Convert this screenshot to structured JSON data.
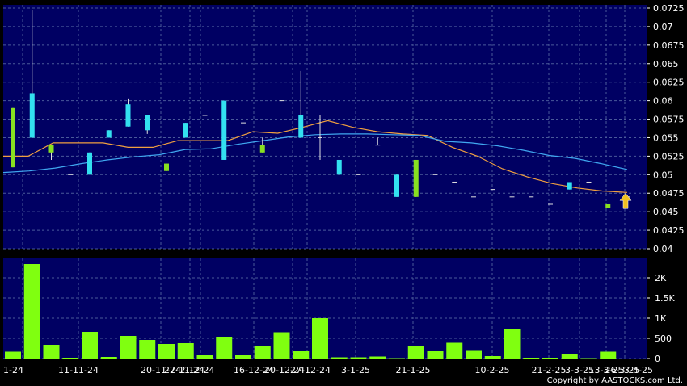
{
  "chart_data": [
    {
      "type": "candlestick",
      "title": "",
      "ylabel": "",
      "ylim": [
        0.04,
        0.0725
      ],
      "y_ticks": [
        "0.04",
        "0.0425",
        "0.045",
        "0.0475",
        "0.05",
        "0.0525",
        "0.055",
        "0.0575",
        "0.06",
        "0.0625",
        "0.065",
        "0.0675",
        "0.07",
        "0.0725"
      ],
      "x_ticks": [
        "1-24",
        "11-11-24",
        "20-11-24",
        "27-11-24",
        "2-12-24",
        "16-12-24",
        "20-12-24",
        "27-12-24",
        "3-1-25",
        "21-1-25",
        "10-2-25",
        "21-2-25",
        "3-3-25",
        "13-3-25",
        "26-3-25",
        "3-4-25"
      ],
      "grid": true,
      "colors": {
        "up": "#33e0f0",
        "down": "#88e020",
        "ma_short": "#f0a040",
        "ma_long": "#40a8f0",
        "arrow": "#f0c020"
      },
      "candles": [
        {
          "o": 0.051,
          "h": 0.059,
          "l": 0.051,
          "c": 0.059,
          "color": "down"
        },
        {
          "o": 0.055,
          "h": 0.0722,
          "l": 0.055,
          "c": 0.061,
          "color": "up"
        },
        {
          "o": 0.054,
          "h": 0.054,
          "l": 0.052,
          "c": 0.053,
          "color": "down"
        },
        {
          "o": 0.05,
          "h": 0.05,
          "l": 0.05,
          "c": 0.05,
          "color": "flat"
        },
        {
          "o": 0.05,
          "h": 0.053,
          "l": 0.05,
          "c": 0.053,
          "color": "up"
        },
        {
          "o": 0.055,
          "h": 0.056,
          "l": 0.055,
          "c": 0.056,
          "color": "up"
        },
        {
          "o": 0.0565,
          "h": 0.0603,
          "l": 0.0565,
          "c": 0.0595,
          "color": "up"
        },
        {
          "o": 0.056,
          "h": 0.058,
          "l": 0.0555,
          "c": 0.058,
          "color": "up"
        },
        {
          "o": 0.0515,
          "h": 0.0515,
          "l": 0.0505,
          "c": 0.0505,
          "color": "down"
        },
        {
          "o": 0.055,
          "h": 0.057,
          "l": 0.055,
          "c": 0.057,
          "color": "up"
        },
        {
          "o": 0.058,
          "h": 0.058,
          "l": 0.058,
          "c": 0.058,
          "color": "flat"
        },
        {
          "o": 0.052,
          "h": 0.06,
          "l": 0.052,
          "c": 0.06,
          "color": "up"
        },
        {
          "o": 0.057,
          "h": 0.057,
          "l": 0.057,
          "c": 0.057,
          "color": "flat"
        },
        {
          "o": 0.054,
          "h": 0.055,
          "l": 0.053,
          "c": 0.053,
          "color": "down"
        },
        {
          "o": 0.06,
          "h": 0.06,
          "l": 0.06,
          "c": 0.06,
          "color": "flat"
        },
        {
          "o": 0.055,
          "h": 0.064,
          "l": 0.055,
          "c": 0.058,
          "color": "up"
        },
        {
          "o": 0.055,
          "h": 0.058,
          "l": 0.052,
          "c": 0.055,
          "color": "flat"
        },
        {
          "o": 0.05,
          "h": 0.052,
          "l": 0.05,
          "c": 0.052,
          "color": "up"
        },
        {
          "o": 0.05,
          "h": 0.05,
          "l": 0.05,
          "c": 0.05,
          "color": "flat"
        },
        {
          "o": 0.054,
          "h": 0.055,
          "l": 0.054,
          "c": 0.054,
          "color": "flat"
        },
        {
          "o": 0.047,
          "h": 0.05,
          "l": 0.047,
          "c": 0.05,
          "color": "up"
        },
        {
          "o": 0.052,
          "h": 0.052,
          "l": 0.047,
          "c": 0.047,
          "color": "down"
        },
        {
          "o": 0.05,
          "h": 0.05,
          "l": 0.05,
          "c": 0.05,
          "color": "flat"
        },
        {
          "o": 0.049,
          "h": 0.049,
          "l": 0.049,
          "c": 0.049,
          "color": "flat"
        },
        {
          "o": 0.047,
          "h": 0.047,
          "l": 0.047,
          "c": 0.047,
          "color": "flat"
        },
        {
          "o": 0.048,
          "h": 0.048,
          "l": 0.048,
          "c": 0.048,
          "color": "flat"
        },
        {
          "o": 0.047,
          "h": 0.047,
          "l": 0.047,
          "c": 0.047,
          "color": "flat"
        },
        {
          "o": 0.047,
          "h": 0.047,
          "l": 0.047,
          "c": 0.047,
          "color": "flat"
        },
        {
          "o": 0.046,
          "h": 0.046,
          "l": 0.046,
          "c": 0.046,
          "color": "flat"
        },
        {
          "o": 0.048,
          "h": 0.049,
          "l": 0.048,
          "c": 0.049,
          "color": "up"
        },
        {
          "o": 0.049,
          "h": 0.049,
          "l": 0.049,
          "c": 0.049,
          "color": "flat"
        },
        {
          "o": 0.046,
          "h": 0.046,
          "l": 0.0455,
          "c": 0.0455,
          "color": "down"
        },
        {
          "o": 0.047,
          "h": 0.047,
          "l": 0.047,
          "c": 0.047,
          "color": "flat"
        }
      ],
      "series": [
        {
          "values": [
            0.0525,
            0.0525,
            0.0543,
            0.0543,
            0.0543,
            0.0537,
            0.0537,
            0.0546,
            0.0546,
            0.0546,
            0.0558,
            0.0556,
            0.0564,
            0.0573,
            0.0564,
            0.0558,
            0.0555,
            0.0553,
            0.0537,
            0.0525,
            0.0508,
            0.0497,
            0.0488,
            0.0482,
            0.0478,
            0.0476
          ]
        },
        {
          "values": [
            0.0503,
            0.0505,
            0.0509,
            0.0515,
            0.052,
            0.0524,
            0.0527,
            0.0534,
            0.0535,
            0.0541,
            0.0546,
            0.0551,
            0.0554,
            0.0555,
            0.0555,
            0.0554,
            0.0553,
            0.0545,
            0.0543,
            0.0539,
            0.0533,
            0.0526,
            0.0522,
            0.0515,
            0.0507
          ]
        }
      ]
    },
    {
      "type": "bar",
      "ylabel": "",
      "ylim": [
        0,
        2400
      ],
      "y_ticks": [
        "0",
        "500",
        "1K",
        "1.5K",
        "2K"
      ],
      "values": [
        170,
        2340,
        340,
        20,
        660,
        40,
        560,
        460,
        360,
        380,
        80,
        540,
        80,
        320,
        650,
        180,
        1000,
        30,
        30,
        50,
        10,
        310,
        180,
        390,
        190,
        60,
        740,
        20,
        20,
        120,
        10,
        170,
        0
      ],
      "color": "#80ff10"
    }
  ],
  "copyright": "Copyright by AASTOCKS.com Ltd."
}
